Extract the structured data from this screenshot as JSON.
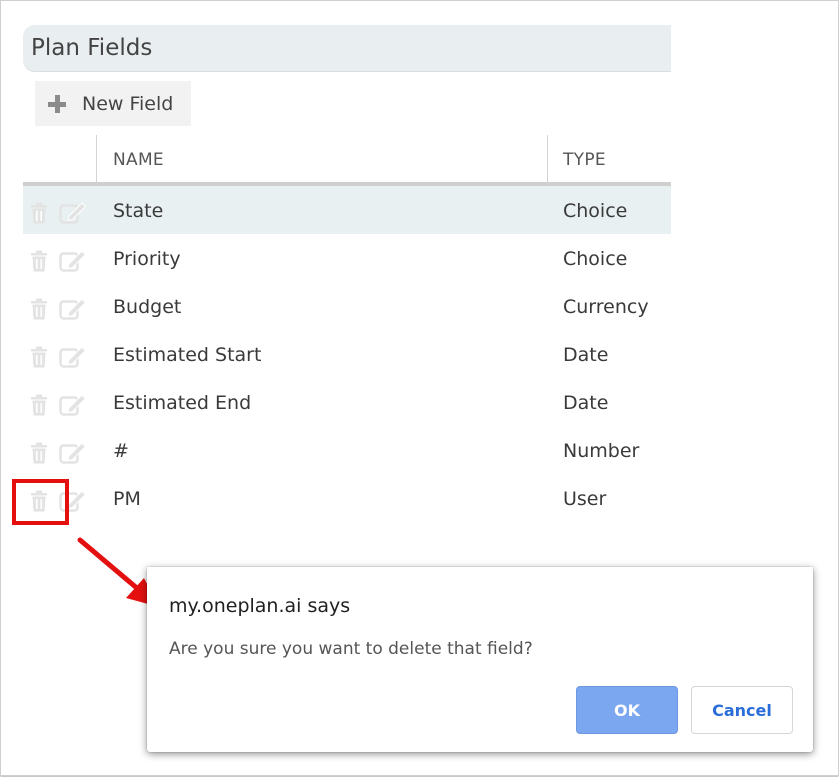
{
  "section": {
    "title": "Plan Fields"
  },
  "toolbar": {
    "new_field_label": "New Field"
  },
  "table": {
    "columns": [
      "NAME",
      "TYPE"
    ],
    "rows": [
      {
        "name": "State",
        "type": "Choice"
      },
      {
        "name": "Priority",
        "type": "Choice"
      },
      {
        "name": "Budget",
        "type": "Currency"
      },
      {
        "name": "Estimated Start",
        "type": "Date"
      },
      {
        "name": "Estimated End",
        "type": "Date"
      },
      {
        "name": "#",
        "type": "Number"
      },
      {
        "name": "PM",
        "type": "User"
      }
    ]
  },
  "dialog": {
    "title": "my.oneplan.ai says",
    "message": "Are you sure you want to delete that field?",
    "ok_label": "OK",
    "cancel_label": "Cancel"
  },
  "colors": {
    "annotation_red": "#e41010",
    "ok_button": "#7ba7f0",
    "cancel_text": "#2a6dd8",
    "row_highlight": "#e8f0f2"
  }
}
